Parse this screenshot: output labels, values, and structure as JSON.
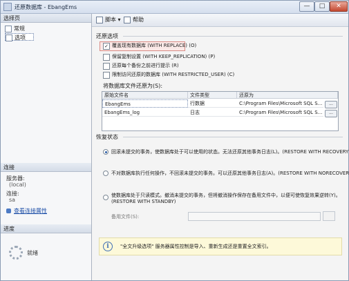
{
  "window": {
    "title": "还原数据库 - EbangEms",
    "min": "—",
    "max": "□",
    "close": "✕"
  },
  "sidebar": {
    "select_page_header": "选择页",
    "pages": [
      {
        "label": "常规"
      },
      {
        "label": "选项"
      }
    ],
    "connection_header": "连接",
    "server_label": "服务器:",
    "server_value": "(local)",
    "connection_label": "连接:",
    "connection_value": "sa",
    "view_connection_link": "查看连接属性",
    "progress_header": "进度",
    "progress_status": "就绪"
  },
  "toolbar": {
    "script_label": "脚本",
    "help_label": "帮助"
  },
  "restore_options": {
    "header": "还原选项",
    "options": [
      {
        "label": "覆盖现有数据库 (WITH REPLACE) (O)",
        "checked": true
      },
      {
        "label": "保留复制设置 (WITH KEEP_REPLICATION) (P)",
        "checked": false
      },
      {
        "label": "还原每个备份之前进行提示 (R)",
        "checked": false
      },
      {
        "label": "限制访问还原的数据库 (WITH RESTRICTED_USER) (C)",
        "checked": false
      }
    ]
  },
  "files": {
    "label": "将数据库文件还原为(S):",
    "columns": [
      "原始文件名",
      "文件类型",
      "还原为"
    ],
    "rows": [
      {
        "name": "EbangEms",
        "type": "行数据",
        "path": "C:\\Program Files\\Microsoft SQL S..."
      },
      {
        "name": "EbangEms_log",
        "type": "日志",
        "path": "C:\\Program Files\\Microsoft SQL S..."
      }
    ],
    "browse_label": "..."
  },
  "recovery": {
    "header": "恢复状态",
    "options": [
      {
        "text": "回滚未提交的事务，使数据库处于可以使用的状态。无法还原其他事务日志(L)。(RESTORE WITH RECOVERY)",
        "selected": true
      },
      {
        "text": "不对数据库执行任何操作，不回滚未提交的事务。可以还原其他事务日志(A)。(RESTORE WITH NORECOVERY)",
        "selected": false
      },
      {
        "text_line1": "使数据库处于只读模式。撤消未提交的事务，但将撤消操作保存在备用文件中，以便可使恢复效果逆转(Y)。",
        "text_line2": "(RESTORE WITH STANDBY)",
        "selected": false
      }
    ],
    "standby_label": "备用文件(S):",
    "standby_value": ""
  },
  "info": {
    "text": "\"全文升级选项\" 服务器属性控制是导入、重新生成还是重置全文索引。"
  }
}
